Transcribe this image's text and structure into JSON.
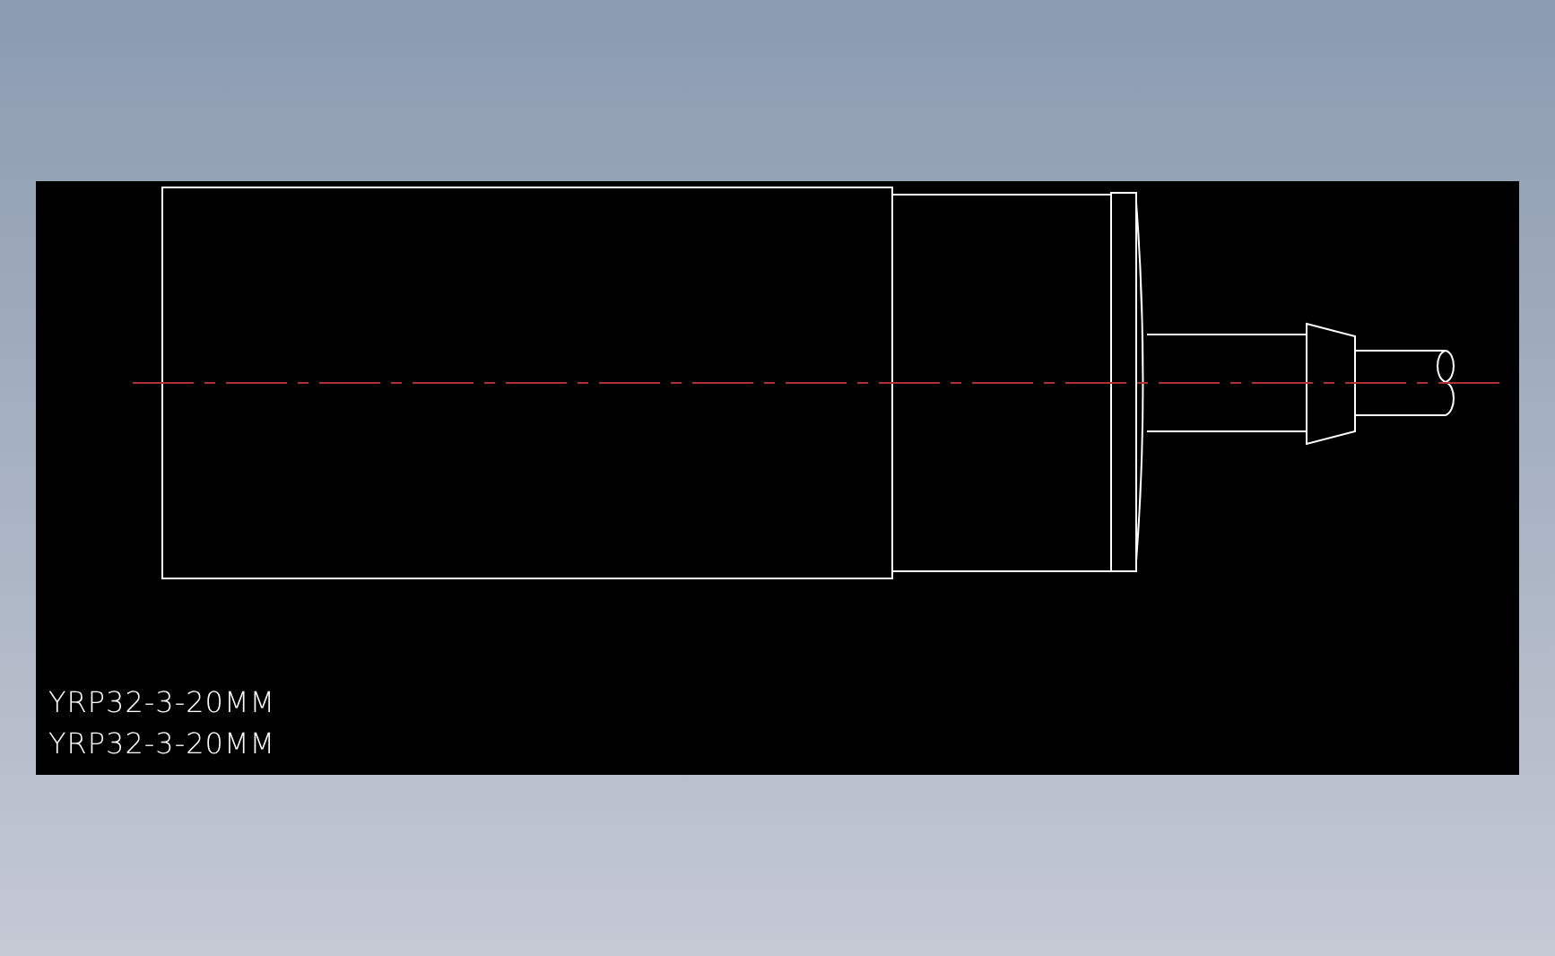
{
  "labels": [
    "YRP32-3-20MM",
    "YRP32-3-20MM"
  ]
}
